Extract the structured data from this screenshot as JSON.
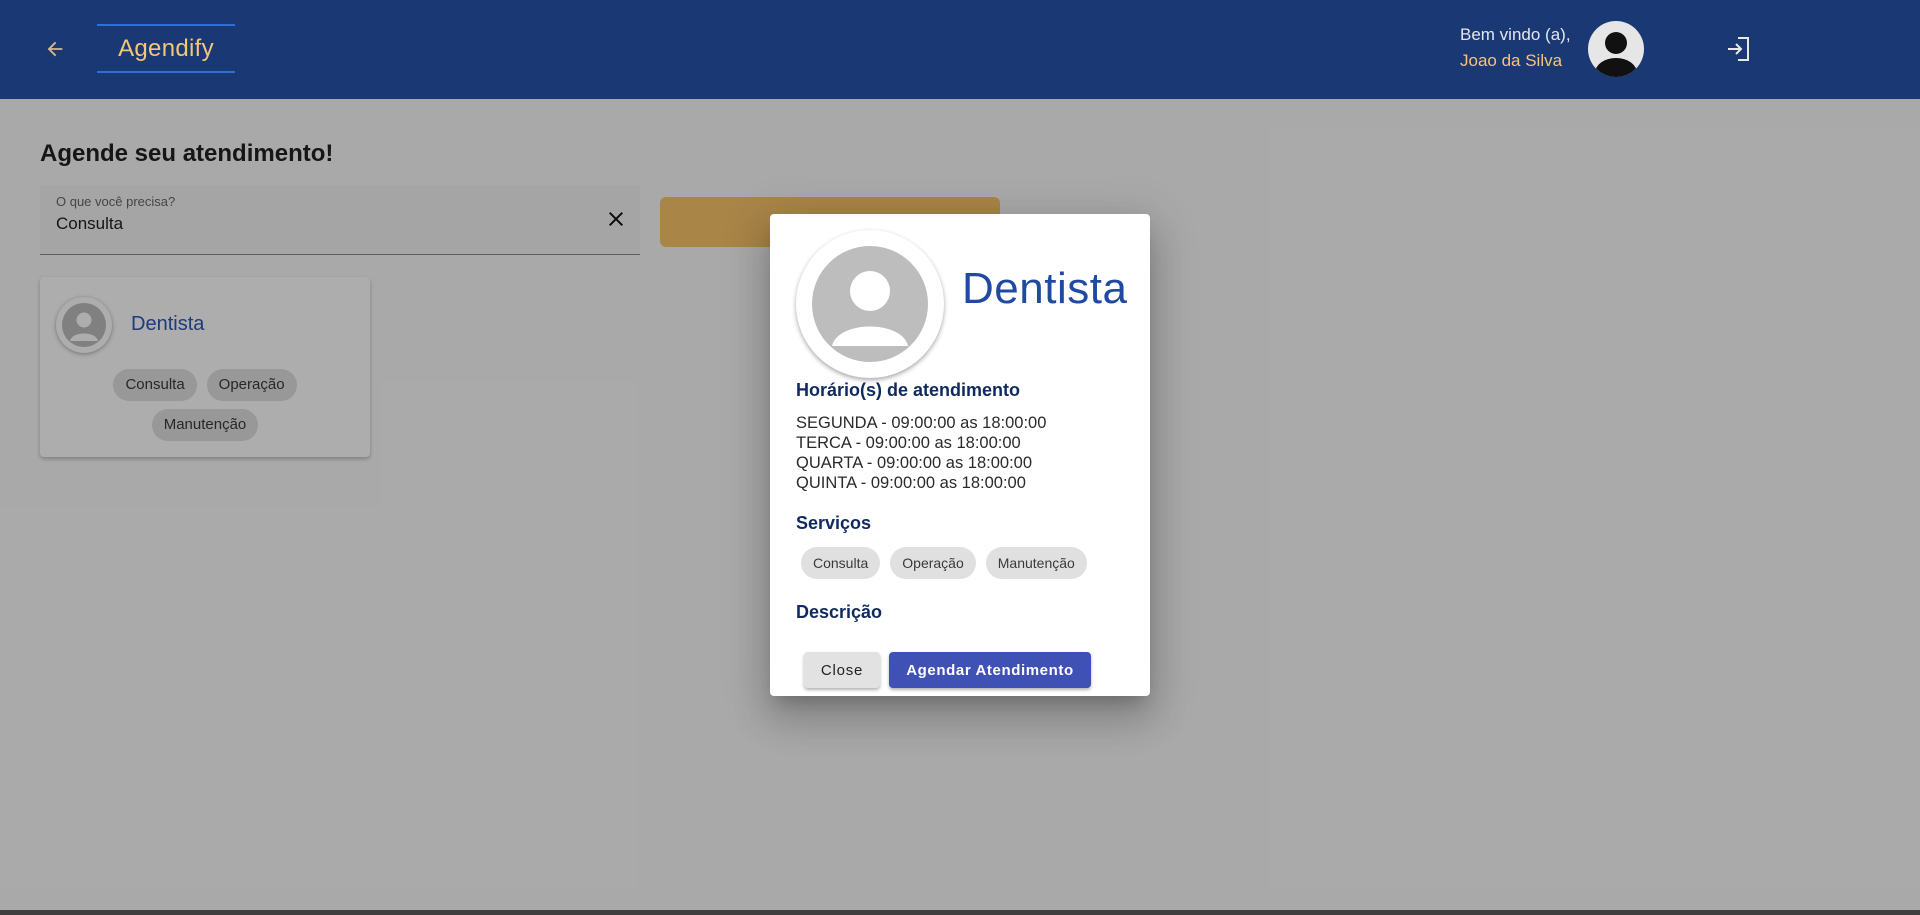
{
  "header": {
    "brand": "Agendify",
    "welcome": "Bem vindo (a),",
    "user_name": "Joao da Silva"
  },
  "page": {
    "title": "Agende seu atendimento!",
    "search": {
      "label": "O que você precisa?",
      "value": "Consulta"
    }
  },
  "results": [
    {
      "name": "Dentista",
      "services": [
        "Consulta",
        "Operação",
        "Manutenção"
      ]
    }
  ],
  "dialog": {
    "title": "Dentista",
    "hours_heading": "Horário(s) de atendimento",
    "hours": [
      "SEGUNDA - 09:00:00 as 18:00:00",
      "TERCA - 09:00:00 as 18:00:00",
      "QUARTA - 09:00:00 as 18:00:00",
      "QUINTA - 09:00:00 as 18:00:00"
    ],
    "services_heading": "Serviços",
    "services": [
      "Consulta",
      "Operação",
      "Manutenção"
    ],
    "description_heading": "Descrição",
    "close_label": "Close",
    "schedule_label": "Agendar Atendimento"
  },
  "colors": {
    "topbar": "#1a3873",
    "accent_gold": "#f4c57a",
    "primary_button": "#3f51b5",
    "title_blue": "#1f49a3"
  },
  "icons": [
    "arrow-left-icon",
    "user-avatar-icon",
    "logout-icon",
    "close-icon",
    "person-placeholder-icon"
  ]
}
